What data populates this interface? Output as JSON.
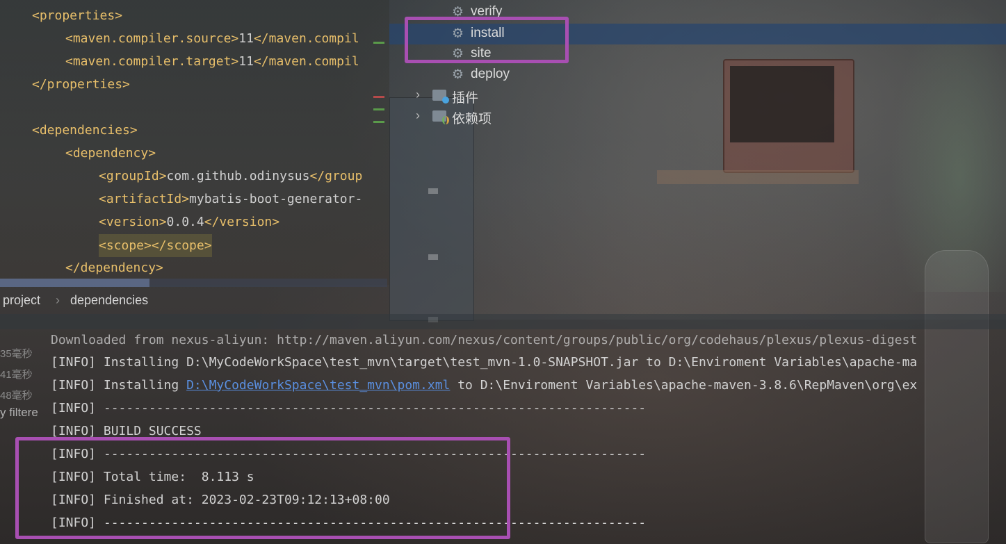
{
  "editor": {
    "lines": [
      {
        "open": "<properties>",
        "text": "",
        "close": ""
      },
      {
        "open": "<maven.compiler.source>",
        "text": "11",
        "close": "</maven.compil"
      },
      {
        "open": "<maven.compiler.target>",
        "text": "11",
        "close": "</maven.compil"
      },
      {
        "open": "</properties>",
        "text": "",
        "close": ""
      },
      {
        "open": "<dependencies>",
        "text": "",
        "close": ""
      },
      {
        "open": "<dependency>",
        "text": "",
        "close": ""
      },
      {
        "open": "<groupId>",
        "text": "com.github.odinysus",
        "close": "</group"
      },
      {
        "open": "<artifactId>",
        "text": "mybatis-boot-generator-",
        "close": ""
      },
      {
        "open": "<version>",
        "text": "0.0.4",
        "close": "</version>"
      },
      {
        "open": "<scope>",
        "text": "",
        "close": "</scope>"
      },
      {
        "open": "</dependency>",
        "text": "",
        "close": ""
      }
    ]
  },
  "breadcrumb": {
    "items": [
      "project",
      "›",
      "dependencies"
    ]
  },
  "maven_panel": {
    "lifecycle": [
      "verify",
      "install",
      "site",
      "deploy"
    ],
    "selected": "install",
    "groups": [
      "插件",
      "依赖项"
    ],
    "icons": {
      "goal": "gear-icon",
      "plugins": "plugins-folder-icon",
      "deps": "dependencies-folder-icon"
    }
  },
  "console": {
    "side_times": [
      "35毫秒",
      "41毫秒",
      "48毫秒"
    ],
    "filtered_label": "y filtere",
    "partial_top": "Downloaded from nexus-aliyun: http://maven.aliyun.com/nexus/content/groups/public/org/codehaus/plexus/plexus-digest",
    "lines": [
      {
        "prefix": "[INFO] Installing D:\\MyCodeWorkSpace\\test_mvn\\target\\test_mvn-1.0-SNAPSHOT.jar to D:\\Enviroment Variables\\apache-ma",
        "link": "",
        "suffix": ""
      },
      {
        "prefix": "[INFO] Installing ",
        "link": "D:\\MyCodeWorkSpace\\test_mvn\\pom.xml",
        "suffix": " to D:\\Enviroment Variables\\apache-maven-3.8.6\\RepMaven\\org\\ex"
      },
      {
        "prefix": "[INFO] ------------------------------------------------------------------------",
        "link": "",
        "suffix": ""
      },
      {
        "prefix": "[INFO] BUILD SUCCESS",
        "link": "",
        "suffix": ""
      },
      {
        "prefix": "[INFO] ------------------------------------------------------------------------",
        "link": "",
        "suffix": ""
      },
      {
        "prefix": "[INFO] Total time:  8.113 s",
        "link": "",
        "suffix": ""
      },
      {
        "prefix": "[INFO] Finished at: 2023-02-23T09:12:13+08:00",
        "link": "",
        "suffix": ""
      },
      {
        "prefix": "[INFO] ------------------------------------------------------------------------",
        "link": "",
        "suffix": ""
      }
    ]
  },
  "colors": {
    "highlight_box": "#a84fb2",
    "tag": "#e8bf6a",
    "link": "#5a8fe0",
    "selection": "#28466e"
  }
}
